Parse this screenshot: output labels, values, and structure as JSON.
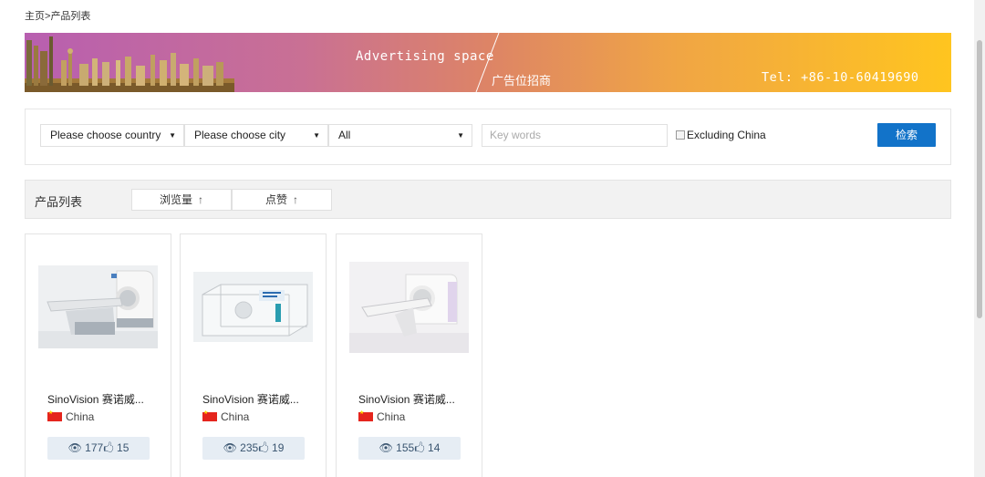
{
  "breadcrumb": {
    "home": "主页",
    "separator": ">",
    "current": "产品列表"
  },
  "banner": {
    "ad_text_en": "Advertising space",
    "ad_text_cn": "广告位招商",
    "tel": "Tel: +86-10-60419690",
    "colors": [
      "#b85fb0",
      "#dd8466",
      "#ffc51f"
    ]
  },
  "filters": {
    "country": "Please choose country",
    "city": "Please choose city",
    "category": "All",
    "keywords_placeholder": "Key words",
    "excluding_label": "Excluding China",
    "excluding_checked": false,
    "search_label": "检索",
    "accent": "#1273c9"
  },
  "list": {
    "title": "产品列表",
    "sort_views": "浏览量",
    "sort_likes": "点赞",
    "sort_icon": "up-arrow-icon"
  },
  "products": [
    {
      "name": "SinoVision 赛诺威...",
      "country": "China",
      "views": "177",
      "likes": "15"
    },
    {
      "name": "SinoVision 赛诺威...",
      "country": "China",
      "views": "235",
      "likes": "19"
    },
    {
      "name": "SinoVision 赛诺威...",
      "country": "China",
      "views": "155",
      "likes": "14"
    }
  ]
}
